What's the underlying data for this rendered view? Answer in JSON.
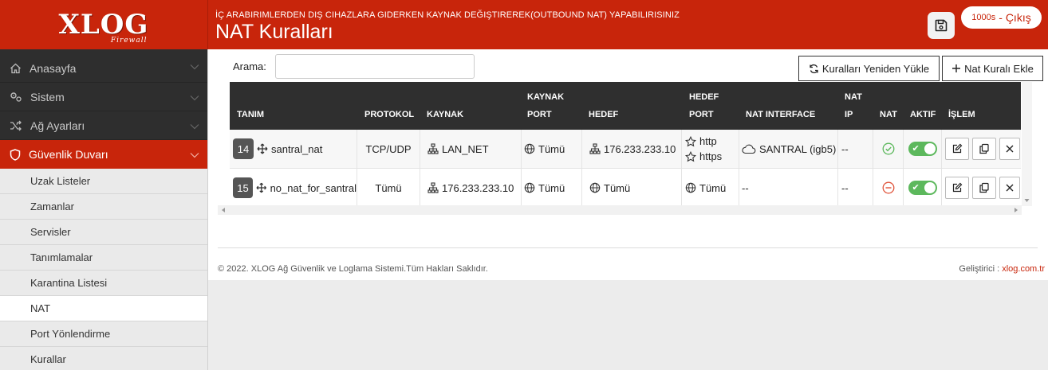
{
  "brand": {
    "logo_text": "XLOG",
    "logo_sub": "Firewall"
  },
  "header": {
    "subtitle": "İÇ ARABIRIMLERDEN DIŞ CIHAZLARA GIDERKEN KAYNAK DEĞIŞTIREREK(OUTBOUND NAT) YAPABILIRISINIZ",
    "title": "NAT Kuralları",
    "session_timer": "1000s",
    "logout_label": "- Çıkış"
  },
  "sidebar": {
    "groups": [
      {
        "label": "Anasayfa",
        "icon": "home-icon"
      },
      {
        "label": "Sistem",
        "icon": "gears-icon"
      },
      {
        "label": "Ağ Ayarları",
        "icon": "shuffle-icon"
      },
      {
        "label": "Güvenlik Duvarı",
        "icon": "shield-icon"
      }
    ],
    "sub_items": [
      "Uzak Listeler",
      "Zamanlar",
      "Servisler",
      "Tanımlamalar",
      "Karantina Listesi",
      "NAT",
      "Port Yönlendirme",
      "Kurallar"
    ],
    "active_sub": "NAT"
  },
  "toolbar": {
    "search_label": "Arama:",
    "search_value": "",
    "reload_label": "Kuralları Yeniden Yükle",
    "add_label": "Nat Kuralı Ekle"
  },
  "table": {
    "headers": {
      "tanim": "TANIM",
      "protokol": "PROTOKOL",
      "kaynak": "KAYNAK",
      "kaynak_port_1": "KAYNAK",
      "kaynak_port_2": "PORT",
      "hedef": "HEDEF",
      "hedef_port_1": "HEDEF",
      "hedef_port_2": "PORT",
      "nat_interface": "NAT INTERFACE",
      "nat_ip_1": "NAT",
      "nat_ip_2": "IP",
      "nat": "NAT",
      "aktif": "AKTIF",
      "islem": "İŞLEM"
    },
    "rows": [
      {
        "id": "14",
        "name": "santral_nat",
        "protocol": "TCP/UDP",
        "source": "LAN_NET",
        "source_port": "Tümü",
        "destination": "176.233.233.10",
        "dest_port_1": "http",
        "dest_port_2": "https",
        "nat_interface": "SANTRAL (igb5)",
        "nat_ip": "--",
        "nat_status": "enabled",
        "active": true
      },
      {
        "id": "15",
        "name": "no_nat_for_santral",
        "protocol": "Tümü",
        "source": "176.233.233.10",
        "source_port": "Tümü",
        "destination": "Tümü",
        "dest_port": "Tümü",
        "nat_interface": "--",
        "nat_ip": "--",
        "nat_status": "disabled",
        "active": true
      }
    ]
  },
  "footer": {
    "copyright": "© 2022. XLOG Ağ Güvenlik ve Loglama Sistemi.Tüm Hakları Saklıdır.",
    "dev_label": "Geliştirici : ",
    "dev_link": "xlog.com.tr"
  },
  "colors": {
    "brand_red": "#c8250b",
    "dark": "#2e2e2e",
    "toggle_green": "#5cb85c",
    "ok_green": "#5cb85c",
    "stop_red": "#e0553c"
  }
}
